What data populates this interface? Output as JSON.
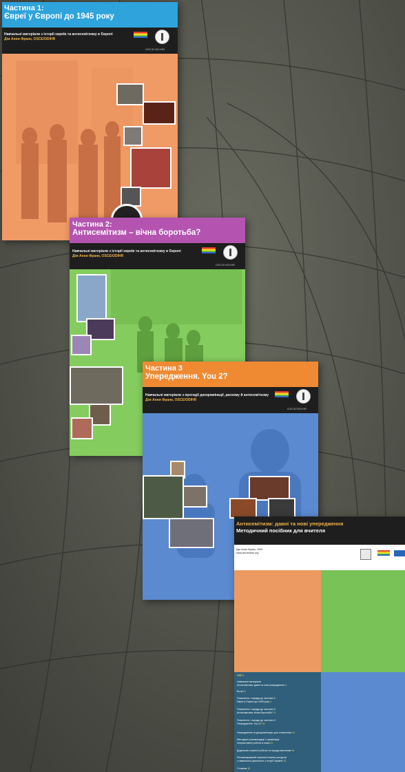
{
  "card1": {
    "line1": "Частина 1:",
    "line2": "Євреї у Європі до 1945 року",
    "sub1": "Навчальні матеріали з історії євреїв та антисемітизму в Європі",
    "sub2": "Дім Анни Франк, OSCE/ODIHR",
    "logo": "OSCE/ODIHR"
  },
  "card2": {
    "line1": "Частина 2:",
    "line2": "Антисемітизм – вічна боротьба?",
    "sub1": "Навчальні матеріали з історії євреїв та антисемітизму в Європі",
    "sub2": "Дім Анни Франк, OSCE/ODIHR",
    "logo": "OSCE/ODIHR"
  },
  "card3": {
    "line1": "Частина 3",
    "line2": "Упередження. You 2?",
    "sub1": "Навчальні матеріали з протидії дискримінації, расизму й антисемітизму",
    "sub2": "Дім Анни Франк, OSCE/ODIHR",
    "logo": "OSCE/ODIHR"
  },
  "card4": {
    "line1": "Антисемітизм: давні та нові упередження",
    "line2": "Методичний посібник для вчителя",
    "pub1": "Дім Анни Франк, 2009",
    "pub2": "www.annefrank.org",
    "toc": [
      {
        "t": "Зміст"
      },
      {
        "t": "Навчальні матеріали",
        "t2": "Антисемітизм: давні та нові упередження",
        "n": "3"
      },
      {
        "t": "Вступ",
        "n": "3"
      },
      {
        "t": "Пояснення і поради до частини 1:",
        "t2": "Євреї у Європі до 1945 року",
        "n": "4"
      },
      {
        "t": "Пояснення і поради до частини 2:",
        "t2": "Антисемітизм: вічна боротьба?",
        "n": "11"
      },
      {
        "t": "Пояснення і поради до частини 3:",
        "t2": "Упередження. You 2?",
        "n": "16"
      },
      {
        "t": "Упередження та дискримінація: для з вчителем",
        "n": "19"
      },
      {
        "t": "Методичні рекомендації з організації",
        "t2": "інтерактивної роботи в класі",
        "n": "22"
      },
      {
        "t": "Додаткові стратегії роботи та поради вчителям",
        "n": "26"
      },
      {
        "t": "Рекомендований перелік інтернет-ресурсів",
        "t2": "з навчальної діяльності з історії України",
        "n": "31"
      },
      {
        "t": "Словник",
        "n": "32"
      }
    ]
  },
  "colors": {
    "card1_top": "#2ea3dc",
    "card1_body": "#f29f6c",
    "card2_top": "#b454b0",
    "card2_body": "#7ec85a",
    "card3_top": "#ef8a33",
    "card3_body": "#5f8fd2",
    "card4_toc": "#2f5f7a"
  }
}
